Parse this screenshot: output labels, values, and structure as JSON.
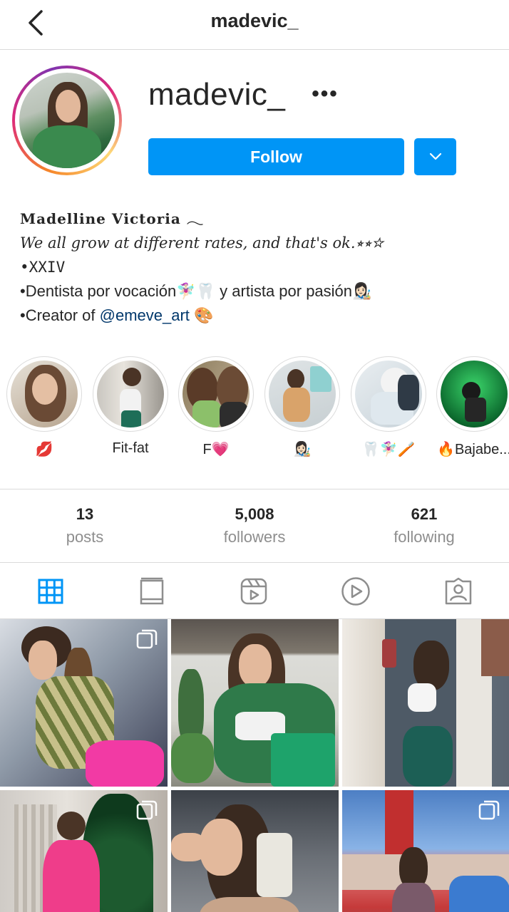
{
  "header": {
    "title": "madevic_"
  },
  "profile": {
    "username": "madevic_",
    "follow_label": "Follow",
    "more_label": "•••"
  },
  "bio": {
    "name": "𝐌𝐚𝐝𝐞𝐥𝐥𝐢𝐧𝐞 𝐕𝐢𝐜𝐭𝐨𝐫𝐢𝐚 𓂃",
    "quote": "We all grow at different rates, and that's ok.⭒⭒☆",
    "line3": "•XXIV",
    "line4": "•Dentista por vocación🧚🏻‍♀️🦷 y artista por pasión👩🏻‍🎨",
    "line5_prefix": "•Creator of ",
    "line5_link": "@emeve_art",
    "line5_suffix": " 🎨"
  },
  "highlights": [
    {
      "label": "💋"
    },
    {
      "label": "Fit-fat"
    },
    {
      "label": "F💗"
    },
    {
      "label": "👩🏻‍🎨"
    },
    {
      "label": "🦷🧚🏻‍♀️🪥"
    },
    {
      "label": "🔥Bajabe..."
    }
  ],
  "stats": {
    "posts": {
      "value": "13",
      "label": "posts"
    },
    "followers": {
      "value": "5,008",
      "label": "followers"
    },
    "following": {
      "value": "621",
      "label": "following"
    }
  },
  "colors": {
    "accent": "#0095f6",
    "link": "#00376b",
    "muted": "#8e8e8e",
    "border": "#dbdbdb"
  },
  "icons": [
    "back-chevron-icon",
    "more-dots-icon",
    "chevron-down-icon",
    "grid-icon",
    "guide-icon",
    "reels-icon",
    "video-icon",
    "tagged-icon",
    "multiple-posts-icon"
  ]
}
